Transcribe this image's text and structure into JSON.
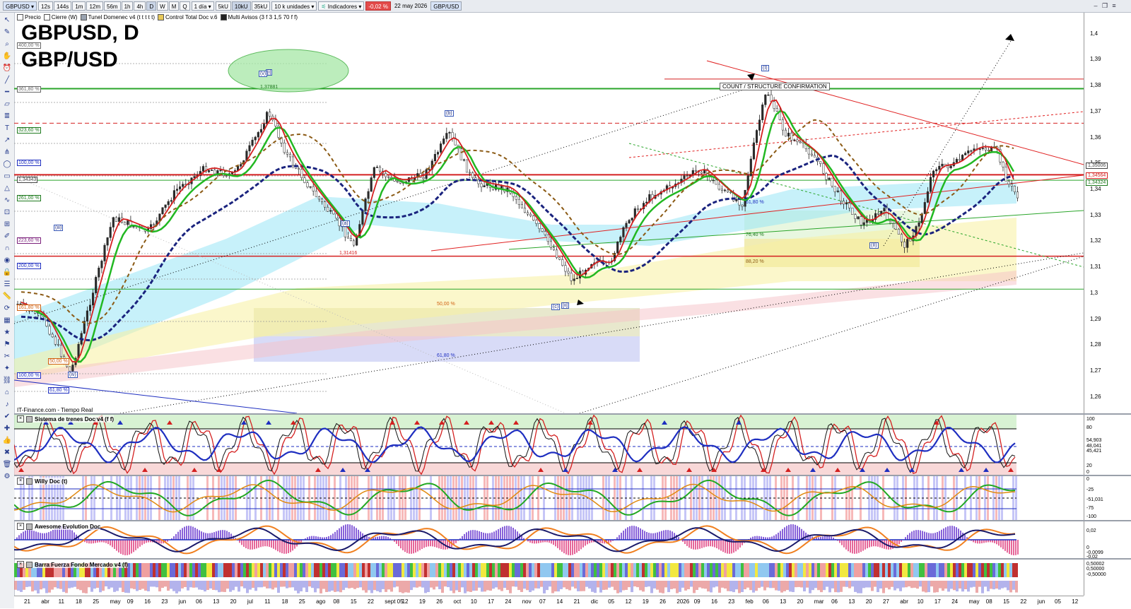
{
  "toolbar": {
    "symbol": "GBPUSD",
    "timeframes": [
      "12s",
      "144s",
      "1m",
      "12m",
      "56m",
      "1h",
      "4h",
      "D",
      "W",
      "M",
      "Q"
    ],
    "active_timeframe": "D",
    "period": "1 día",
    "units": [
      "5kU",
      "10kU",
      "35kU"
    ],
    "active_unit": "10kU",
    "quantity": "10 k unidades",
    "indicators_label": "Indicadores",
    "change": "-0,02 %",
    "date": "22 may 2026",
    "pair_badge": "GBP/USD"
  },
  "legend": [
    {
      "label": "Precio",
      "color": "#ffffff"
    },
    {
      "label": "Cierre (W)",
      "color": "#ffffff"
    },
    {
      "label": "Tunel Domenec v4 (t t t t t)",
      "color": "#9aa3b0"
    },
    {
      "label": "Control Total Doc v.6",
      "color": "#e7c85a"
    },
    {
      "label": "Multi Avisos (3 f 3 1,5 70 f f)",
      "color": "#222222"
    }
  ],
  "chart": {
    "title_line1": "GBPUSD, D",
    "title_line2": "GBP/USD",
    "credit": "IT-Finance.com - Tiempo Real",
    "price_labels": [
      "1,4",
      "1,39",
      "1,38",
      "1,37",
      "1,36",
      "1,35",
      "1,34",
      "1,33",
      "1,32",
      "1,31",
      "1,3",
      "1,29",
      "1,28",
      "1,27",
      "1,26"
    ],
    "price_boxes": [
      {
        "text": "1,35006",
        "color": "#444444"
      },
      {
        "text": "1,34564",
        "color": "#d32020"
      },
      {
        "text": "1,34324",
        "color": "#1e7a1e"
      }
    ],
    "fib_labels": [
      "400,00 %",
      "361,80 %",
      "323,60 %",
      "100,00 %",
      "1,34343",
      "261,00 %",
      "223,60 %",
      "200,00 %",
      "161,80 %",
      "50,00 %",
      "100,00 %",
      "61,80 %"
    ],
    "annotations": [
      "1,37881",
      "1,31416",
      "50,00 %",
      "61,80 %",
      "61,80 %",
      "76,40 %",
      "88,20 %"
    ],
    "wave_labels": [
      "[i]",
      "(iii)",
      "(iv)",
      "(a)",
      "(b)",
      "[ii]",
      "(c)",
      "(I)",
      "(II)",
      "(v)"
    ],
    "count_label": "COUNT / STRUCTURE CONFIRMATION"
  },
  "panels": [
    {
      "title": "Sistema de trenes Doc v4 (f f)",
      "axis": [
        "100",
        "80",
        "54,903",
        "48,041",
        "45,421",
        "20",
        "0"
      ]
    },
    {
      "title": "Willy Doc (t)",
      "axis": [
        "0",
        "-25",
        "-51,031",
        "-75",
        "-100"
      ]
    },
    {
      "title": "Awesome Evolution Doc",
      "axis": [
        "0,02",
        "0",
        "-0,0099",
        "-0,02"
      ]
    },
    {
      "title": "Barra Fuerza Fondo Mercado v4 (f)",
      "axis": [
        "0,50002",
        "0,50000",
        "-0,50000"
      ]
    }
  ],
  "dates": [
    "21",
    "abr",
    "11",
    "18",
    "25",
    "may",
    "09",
    "16",
    "23",
    "jun",
    "06",
    "13",
    "20",
    "jul",
    "11",
    "18",
    "25",
    "ago",
    "08",
    "15",
    "22",
    "sept 05",
    "12",
    "19",
    "26",
    "oct",
    "10",
    "17",
    "24",
    "nov",
    "07",
    "14",
    "21",
    "dic",
    "05",
    "12",
    "19",
    "26",
    "2026",
    "09",
    "16",
    "23",
    "feb",
    "06",
    "13",
    "20",
    "mar",
    "06",
    "13",
    "20",
    "27",
    "abr",
    "10",
    "17",
    "24",
    "may",
    "08",
    "15",
    "22",
    "jun",
    "05",
    "12"
  ],
  "colors": {
    "bull": "#22b822",
    "bear": "#d42020",
    "ma_blue": "#1a237e",
    "resistance": "#e02020",
    "support": "#2aa52a"
  }
}
